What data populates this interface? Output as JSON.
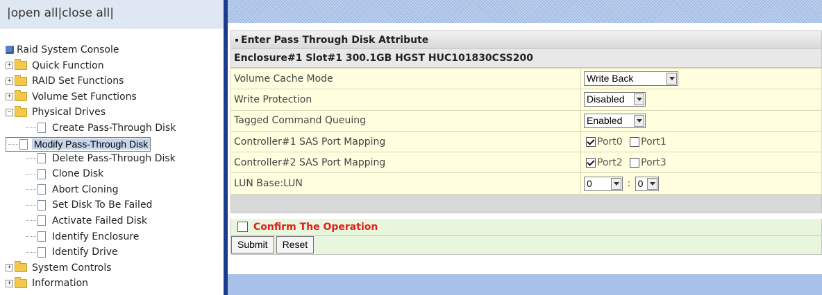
{
  "left": {
    "open_all": "open all",
    "close_all": "close all",
    "root": "Raid System Console",
    "tree": [
      {
        "label": "Quick Function",
        "expanded": false
      },
      {
        "label": "RAID Set Functions",
        "expanded": false
      },
      {
        "label": "Volume Set Functions",
        "expanded": false
      },
      {
        "label": "Physical Drives",
        "expanded": true,
        "children": [
          "Create Pass-Through Disk",
          "Modify Pass-Through Disk",
          "Delete Pass-Through Disk",
          "Clone Disk",
          "Abort Cloning",
          "Set Disk To Be Failed",
          "Activate Failed Disk",
          "Identify Enclosure",
          "Identify Drive"
        ]
      },
      {
        "label": "System Controls",
        "expanded": false
      },
      {
        "label": "Information",
        "expanded": false
      }
    ],
    "selected": "Modify Pass-Through Disk"
  },
  "form": {
    "section_title": "Enter Pass Through Disk Attribute",
    "disk_info": "Enclosure#1 Slot#1 300.1GB HGST HUC101830CSS200",
    "rows": {
      "cache_mode": {
        "label": "Volume Cache Mode",
        "value": "Write Back"
      },
      "write_protection": {
        "label": "Write Protection",
        "value": "Disabled"
      },
      "tcq": {
        "label": "Tagged Command Queuing",
        "value": "Enabled"
      },
      "ctrl1": {
        "label": "Controller#1 SAS Port Mapping",
        "port_a": "Port0",
        "port_a_checked": true,
        "port_b": "Port1",
        "port_b_checked": false
      },
      "ctrl2": {
        "label": "Controller#2 SAS Port Mapping",
        "port_a": "Port2",
        "port_a_checked": true,
        "port_b": "Port3",
        "port_b_checked": false
      },
      "lun": {
        "label": "LUN Base:LUN",
        "base": "0",
        "sep": ":",
        "lun": "0"
      }
    },
    "confirm_label": "Confirm The Operation",
    "confirm_checked": false,
    "submit": "Submit",
    "reset": "Reset"
  },
  "colors": {
    "accent_divider": "#1a3c8c",
    "confirm_text": "#e0201c",
    "row_bg": "#ffffe0",
    "confirm_bg": "#e7f6dc"
  }
}
